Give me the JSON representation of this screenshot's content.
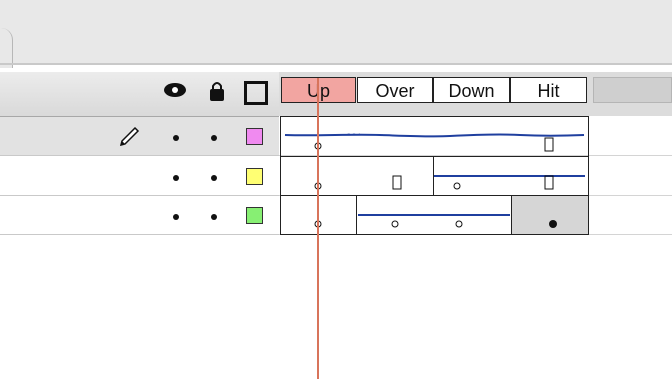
{
  "timeline": {
    "frames": [
      {
        "label": "Up"
      },
      {
        "label": "Over"
      },
      {
        "label": "Down"
      },
      {
        "label": "Hit"
      }
    ],
    "current_frame": "Up",
    "playhead_color": "#d8745b"
  },
  "layers": [
    {
      "swatch_color": "#f08af0",
      "editing": true
    },
    {
      "swatch_color": "#ffff73"
    },
    {
      "swatch_color": "#87ef73"
    }
  ],
  "icons": {
    "eye": "eye-icon",
    "lock": "lock-icon",
    "outline": "outline-square-icon",
    "pencil": "pencil-icon"
  }
}
